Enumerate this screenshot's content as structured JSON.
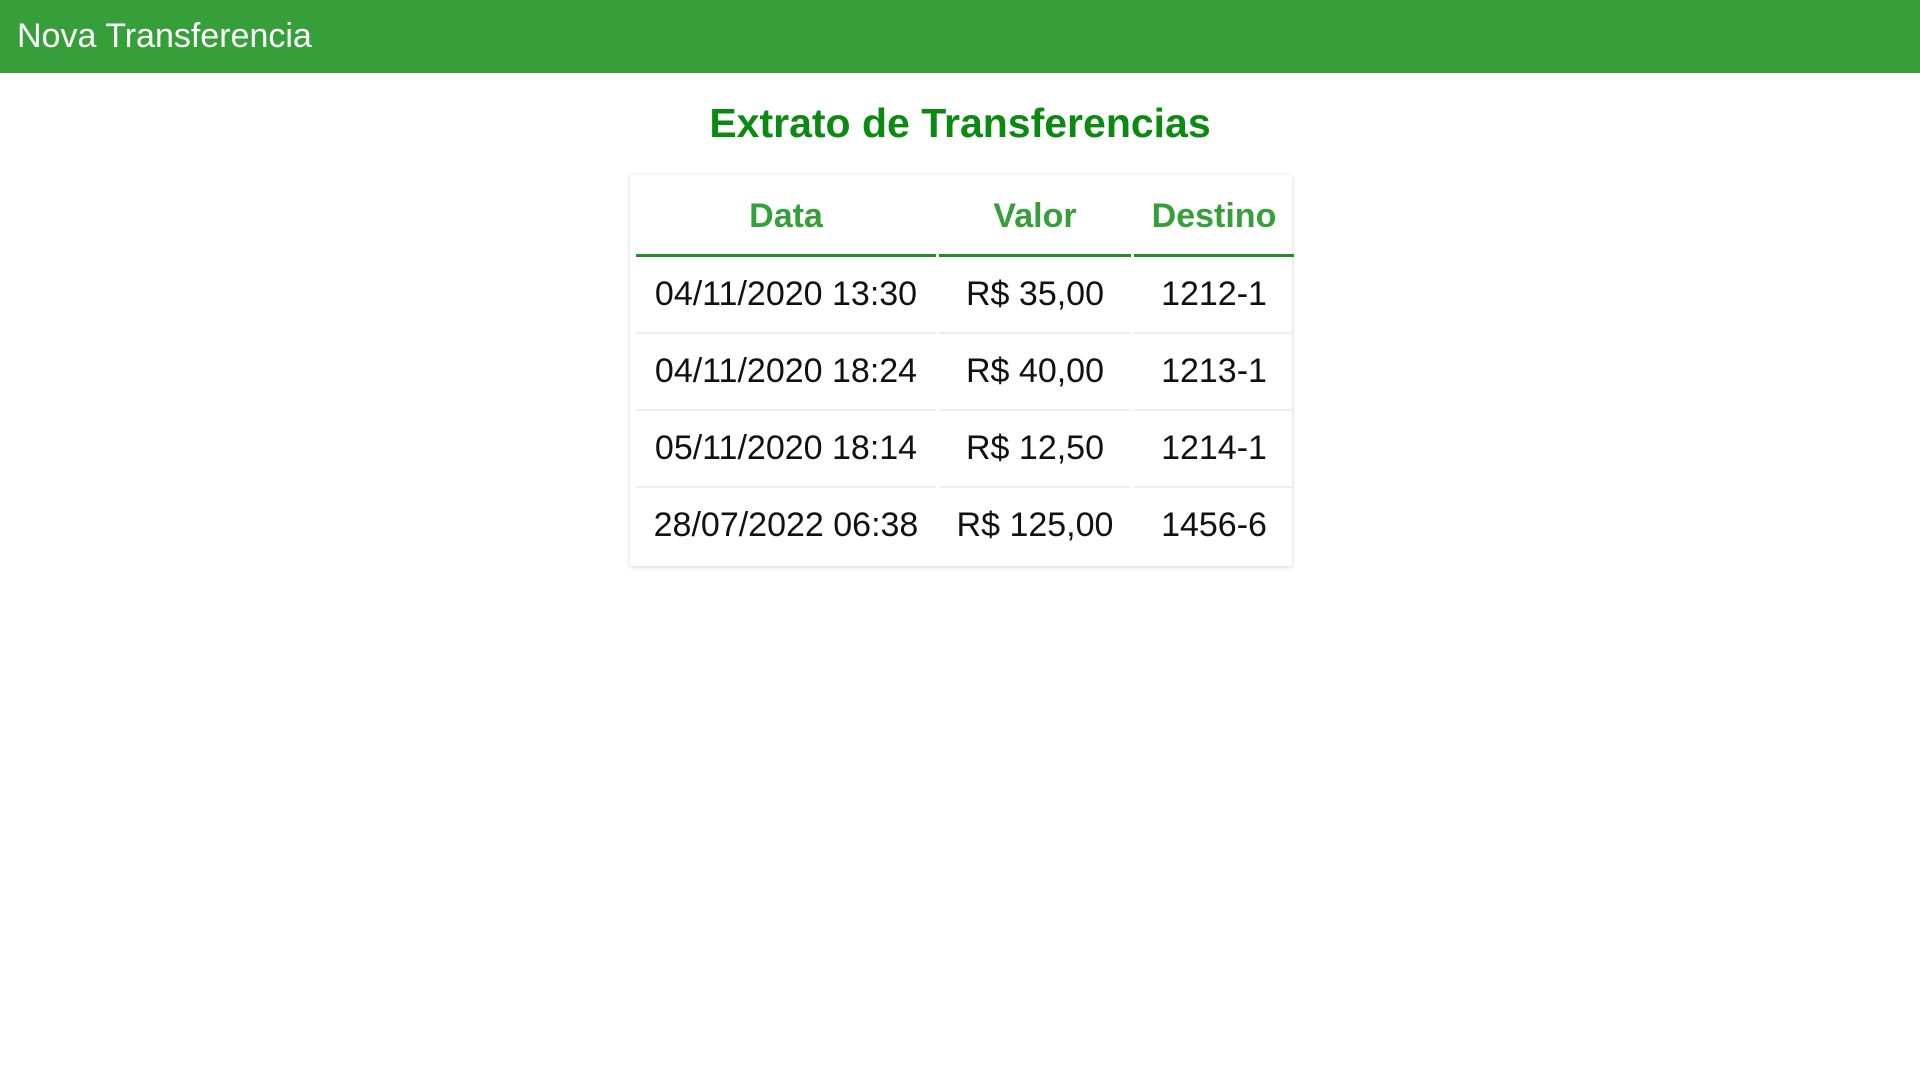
{
  "app_bar": {
    "title": "Nova Transferencia",
    "background": "#369f39"
  },
  "page": {
    "title": "Extrato de Transferencias",
    "title_color": "#0b8a12"
  },
  "table": {
    "columns": [
      "Data",
      "Valor",
      "Destino"
    ],
    "rows": [
      {
        "data": "04/11/2020 13:30",
        "valor": "R$ 35,00",
        "destino": "1212-1"
      },
      {
        "data": "04/11/2020 18:24",
        "valor": "R$ 40,00",
        "destino": "1213-1"
      },
      {
        "data": "05/11/2020 18:14",
        "valor": "R$ 12,50",
        "destino": "1214-1"
      },
      {
        "data": "28/07/2022 06:38",
        "valor": "R$ 125,00",
        "destino": "1456-6"
      }
    ]
  }
}
